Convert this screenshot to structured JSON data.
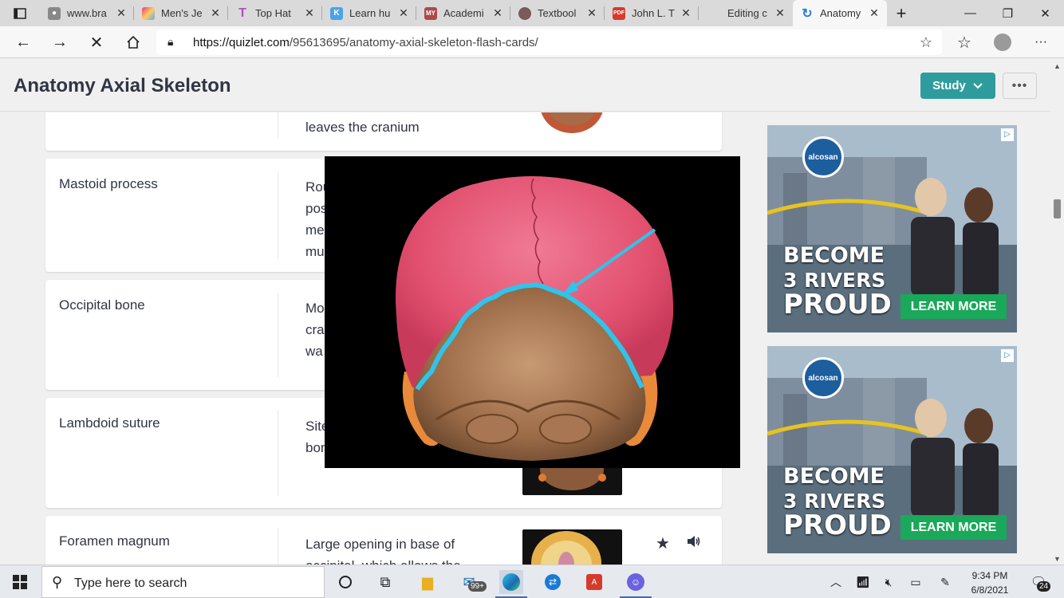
{
  "browser": {
    "tabs": [
      {
        "label": "www.bra",
        "icon": "reddit-icon"
      },
      {
        "label": "Men's Je",
        "icon": "shop-icon"
      },
      {
        "label": "Top Hat",
        "icon": "tophat-icon"
      },
      {
        "label": "Learn hu",
        "icon": "k-icon"
      },
      {
        "label": "Academi",
        "icon": "my-icon"
      },
      {
        "label": "Textbool",
        "icon": "textbook-icon"
      },
      {
        "label": "John L. T",
        "icon": "pdf-icon"
      },
      {
        "label": "Editing c",
        "icon": "none"
      },
      {
        "label": "Anatomy",
        "icon": "quizlet-icon",
        "active": true
      }
    ],
    "url_domain": "https://quizlet.com",
    "url_path": "/95613695/anatomy-axial-skeleton-flash-cards/"
  },
  "page": {
    "title": "Anatomy Axial Skeleton",
    "study_label": "Study",
    "more_label": "•••"
  },
  "cards": [
    {
      "term": "",
      "definition": "leaves the cranium"
    },
    {
      "term": "Mastoid process",
      "definition": "Rou\npos\nme\nmu"
    },
    {
      "term": "Occipital bone",
      "definition": "Mo\ncra\nwa"
    },
    {
      "term": "Lambdoid suture",
      "definition": "Site\nbon"
    },
    {
      "term": "Foramen magnum",
      "definition": "Large opening in base of occipital, which allows the"
    }
  ],
  "ads": {
    "brand": "alcosan",
    "headline_1": "BECOME",
    "headline_2": "3 RIVERS",
    "headline_3": "PROUD",
    "cta": "LEARN MORE"
  },
  "taskbar": {
    "search_placeholder": "Type here to search",
    "mail_badge": "99+",
    "time": "9:34 PM",
    "date": "6/8/2021",
    "notification_count": "24"
  },
  "colors": {
    "study_button": "#2e9c9c",
    "ad_cta": "#1aa85a",
    "suture_highlight": "#2ec4ec"
  }
}
